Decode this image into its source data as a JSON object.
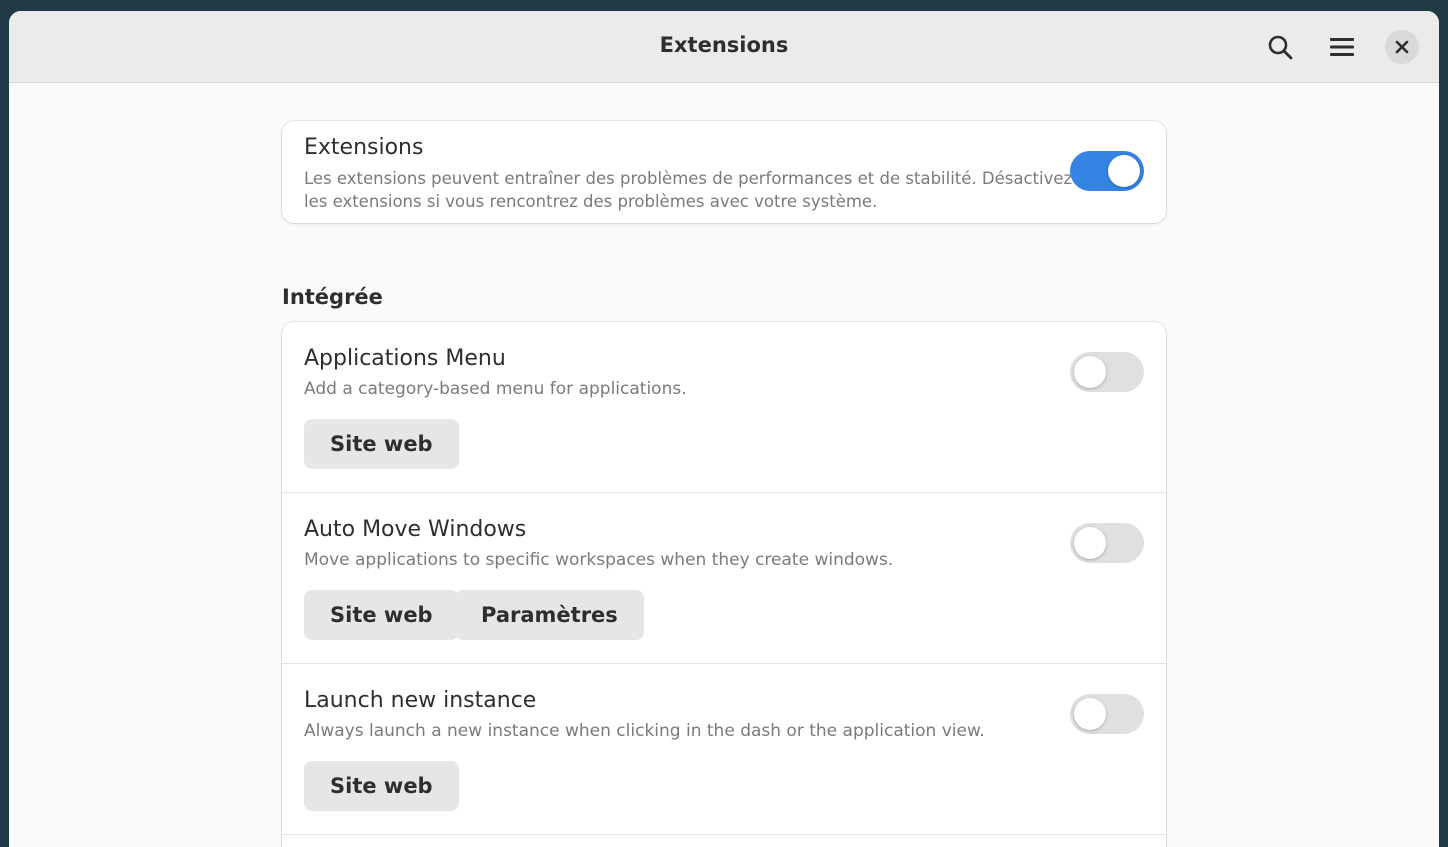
{
  "header": {
    "title": "Extensions",
    "search_icon": "search-icon",
    "menu_icon": "hamburger-menu-icon",
    "close_icon": "close-icon"
  },
  "master": {
    "title": "Extensions",
    "description": "Les extensions peuvent entraîner des problèmes de performances et de stabilité. Désactivez les extensions si vous rencontrez des problèmes avec votre système.",
    "enabled": true
  },
  "section": {
    "title": "Intégrée"
  },
  "extensions": [
    {
      "name": "Applications Menu",
      "description": "Add a category-based menu for applications.",
      "enabled": false,
      "website_label": "Site web"
    },
    {
      "name": "Auto Move Windows",
      "description": "Move applications to specific workspaces when they create windows.",
      "enabled": false,
      "website_label": "Site web",
      "settings_label": "Paramètres"
    },
    {
      "name": "Launch new instance",
      "description": "Always launch a new instance when clicking in the dash or the application view.",
      "enabled": false,
      "website_label": "Site web"
    }
  ],
  "colors": {
    "accent": "#3584e4",
    "window_bg": "#fafafa",
    "header_bg": "#ebebeb",
    "toggle_off": "#e0e0e0",
    "button_bg": "#e6e6e6"
  }
}
